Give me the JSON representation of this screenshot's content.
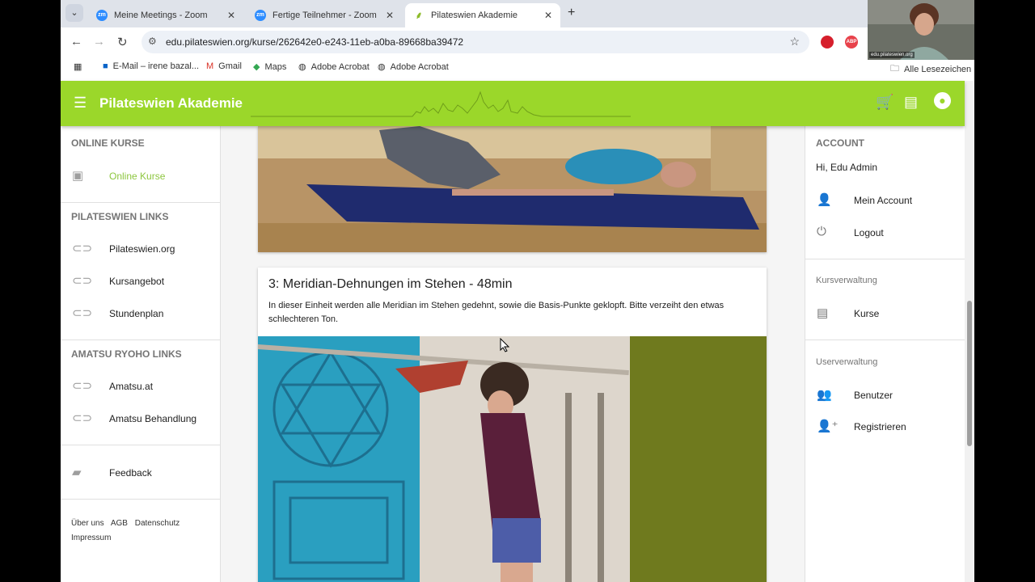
{
  "browser": {
    "tabs": [
      {
        "label": "Meine Meetings - Zoom",
        "icon": "zoom-icon",
        "active": false
      },
      {
        "label": "Fertige Teilnehmer - Zoom",
        "icon": "zoom-icon",
        "active": false
      },
      {
        "label": "Pilateswien Akademie",
        "icon": "leaf-icon",
        "active": true
      }
    ],
    "url": "edu.pilateswien.org/kurse/262642e0-e243-11eb-a0ba-89668ba39472",
    "bookmarks": [
      {
        "label": "E-Mail – irene bazal...",
        "icon": "outlook-icon"
      },
      {
        "label": "Gmail",
        "icon": "gmail-icon"
      },
      {
        "label": "Maps",
        "icon": "maps-icon"
      },
      {
        "label": "Adobe Acrobat",
        "icon": "globe-icon"
      },
      {
        "label": "Adobe Acrobat",
        "icon": "globe-icon"
      }
    ],
    "all_bookmarks": "Alle Lesezeichen",
    "extension_abp": "ABP"
  },
  "app": {
    "title": "Pilateswien Akademie",
    "accent": "#9bd72a"
  },
  "left_nav": {
    "sections": [
      {
        "header": "ONLINE KURSE",
        "items": [
          {
            "label": "Online Kurse",
            "icon": "subscriptions-icon",
            "active": true
          }
        ]
      },
      {
        "header": "PILATESWIEN LINKS",
        "items": [
          {
            "label": "Pilateswien.org",
            "icon": "link-icon"
          },
          {
            "label": "Kursangebot",
            "icon": "link-icon"
          },
          {
            "label": "Stundenplan",
            "icon": "link-icon"
          }
        ]
      },
      {
        "header": "AMATSU RYOHO LINKS",
        "items": [
          {
            "label": "Amatsu.at",
            "icon": "link-icon"
          },
          {
            "label": "Amatsu Behandlung",
            "icon": "link-icon"
          }
        ]
      }
    ],
    "feedback": "Feedback",
    "footer_links": [
      "Über uns",
      "AGB",
      "Datenschutz",
      "Impressum"
    ]
  },
  "main": {
    "lesson": {
      "title": "3: Meridian-Dehnungen im Stehen - 48min",
      "description": "In dieser Einheit werden alle Meridian im Stehen gedehnt, sowie die Basis-Punkte geklopft. Bitte verzeiht den etwas schlechteren Ton."
    }
  },
  "right_nav": {
    "account_header": "ACCOUNT",
    "greeting": "Hi, Edu Admin",
    "account_items": [
      {
        "label": "Mein Account",
        "icon": "person-icon"
      },
      {
        "label": "Logout",
        "icon": "power-icon"
      }
    ],
    "kursverwaltung_header": "Kursverwaltung",
    "kursverwaltung_items": [
      {
        "label": "Kurse",
        "icon": "article-icon"
      }
    ],
    "userverwaltung_header": "Userverwaltung",
    "userverwaltung_items": [
      {
        "label": "Benutzer",
        "icon": "group-icon"
      },
      {
        "label": "Registrieren",
        "icon": "person-add-icon"
      }
    ]
  },
  "webcam": {
    "label": "edu.pilateswien.org"
  }
}
